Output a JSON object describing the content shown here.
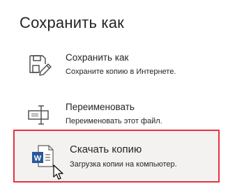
{
  "title": "Сохранить как",
  "items": [
    {
      "label": "Сохранить как",
      "description": "Сохраните копию в Интернете.",
      "icon": "save-as-icon"
    },
    {
      "label": "Переименовать",
      "description": "Переименовать этот файл.",
      "icon": "rename-icon"
    },
    {
      "label": "Скачать копию",
      "description": "Загрузка копии на компьютер.",
      "icon": "word-document-icon"
    }
  ],
  "highlight_color": "#e8303f",
  "word_brand_color": "#2b579a"
}
